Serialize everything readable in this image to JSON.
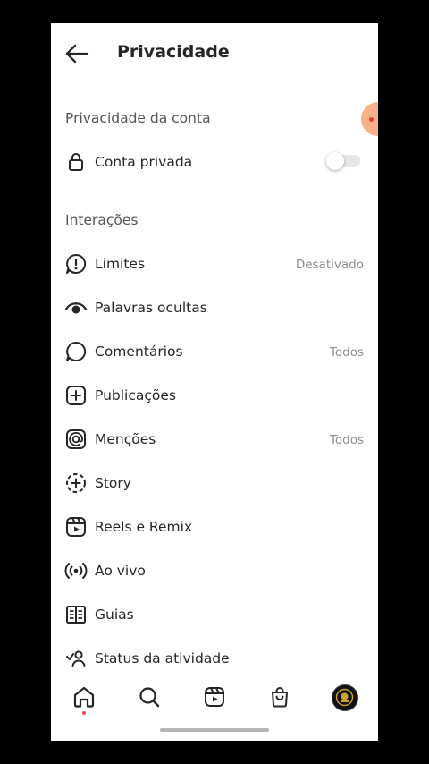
{
  "header": {
    "title": "Privacidade"
  },
  "account_section": {
    "title": "Privacidade da conta",
    "private_account": {
      "label": "Conta privada",
      "enabled": false
    }
  },
  "interactions_section": {
    "title": "Interações",
    "items": [
      {
        "label": "Limites",
        "value": "Desativado",
        "icon": "limits-icon"
      },
      {
        "label": "Palavras ocultas",
        "value": "",
        "icon": "hidden-words-icon"
      },
      {
        "label": "Comentários",
        "value": "Todos",
        "icon": "comment-icon"
      },
      {
        "label": "Publicações",
        "value": "",
        "icon": "add-post-icon"
      },
      {
        "label": "Menções",
        "value": "Todos",
        "icon": "mention-icon"
      },
      {
        "label": "Story",
        "value": "",
        "icon": "story-icon"
      },
      {
        "label": "Reels e Remix",
        "value": "",
        "icon": "reels-icon"
      },
      {
        "label": "Ao vivo",
        "value": "",
        "icon": "live-icon"
      },
      {
        "label": "Guias",
        "value": "",
        "icon": "guides-icon"
      },
      {
        "label": "Status da atividade",
        "value": "",
        "icon": "activity-status-icon"
      }
    ]
  },
  "tabbar": {
    "tabs": [
      "home",
      "search",
      "reels",
      "shop",
      "profile"
    ],
    "active": "home"
  },
  "colors": {
    "text": "#262626",
    "secondary": "#8e8e8e",
    "notification_dot": "#ed4956"
  }
}
